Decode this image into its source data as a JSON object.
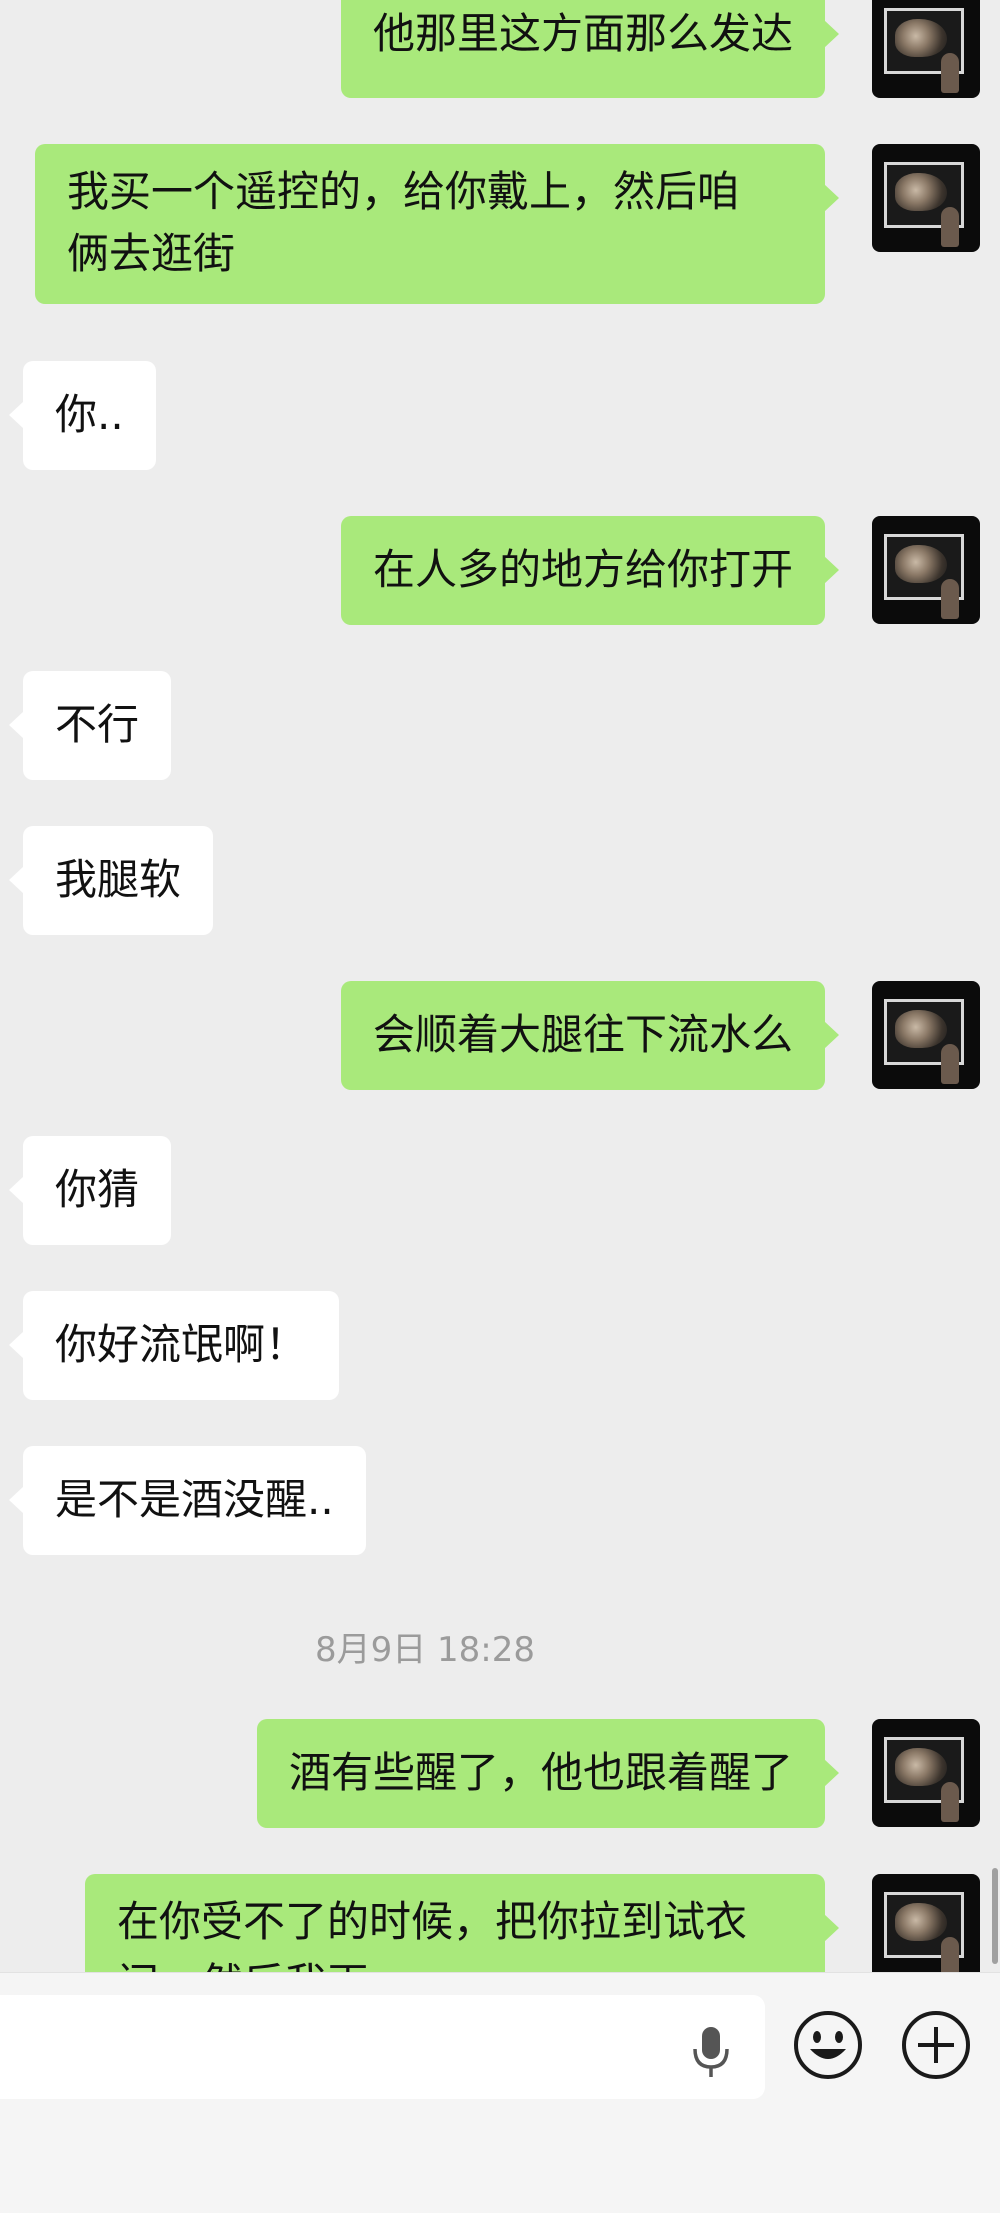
{
  "messages": [
    {
      "side": "out",
      "lines": [
        "他那里这方面那么发达"
      ]
    },
    {
      "side": "out",
      "lines": [
        "我买一个遥控的，给你戴上，然后咱",
        "俩去逛街"
      ]
    },
    {
      "side": "in",
      "lines": [
        "你.."
      ]
    },
    {
      "side": "out",
      "lines": [
        "在人多的地方给你打开"
      ]
    },
    {
      "side": "in",
      "lines": [
        "不行"
      ]
    },
    {
      "side": "in",
      "lines": [
        "我腿软"
      ]
    },
    {
      "side": "out",
      "lines": [
        "会顺着大腿往下流水么"
      ]
    },
    {
      "side": "in",
      "lines": [
        "你猜"
      ]
    },
    {
      "side": "in",
      "lines": [
        "你好流氓啊！"
      ]
    },
    {
      "side": "in",
      "lines": [
        "是不是酒没醒.."
      ]
    },
    {
      "side": "out",
      "lines": [
        "酒有些醒了，他也跟着醒了"
      ]
    },
    {
      "side": "out",
      "lines": [
        "在你受不了的时候，把你拉到试衣",
        "间，然后我再..."
      ]
    }
  ],
  "timestamp": "8月9日 18:28",
  "input_bar": {
    "mic_icon": "microphone-icon",
    "emoji_icon": "smiley-face-icon",
    "plus_icon": "plus-circle-icon"
  },
  "colors": {
    "background": "#ededed",
    "outgoing_bubble": "#a9e97b",
    "incoming_bubble": "#ffffff",
    "timestamp_text": "#9b9b9b",
    "input_bar": "#f5f5f5"
  }
}
